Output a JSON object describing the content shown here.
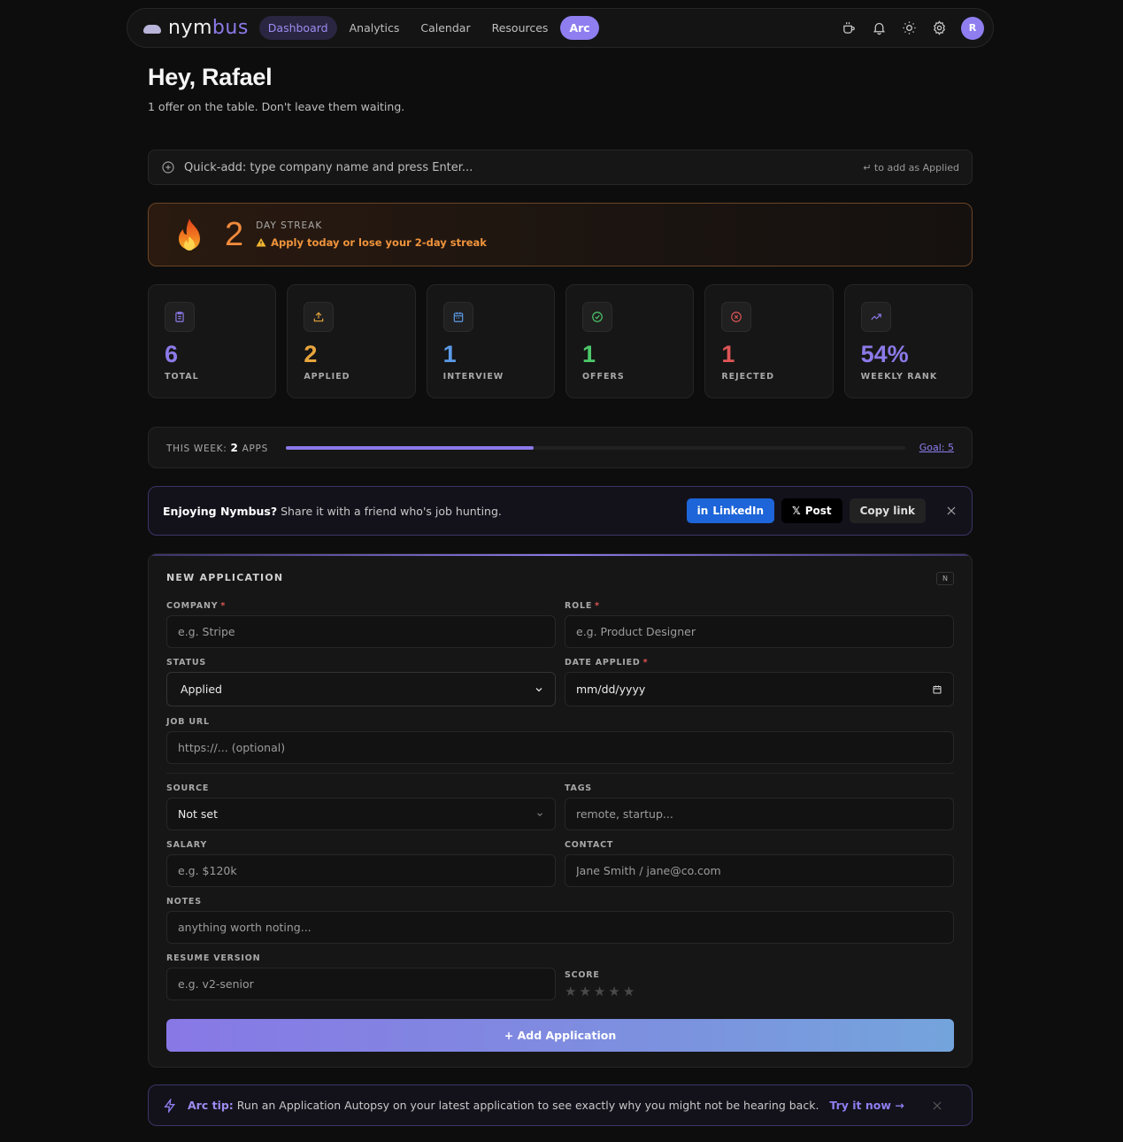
{
  "nav": {
    "logo_main": "nym",
    "logo_accent": "bus",
    "links": [
      {
        "label": "Dashboard",
        "active": true
      },
      {
        "label": "Analytics"
      },
      {
        "label": "Calendar"
      },
      {
        "label": "Resources"
      },
      {
        "label": "Arc"
      }
    ],
    "icons": [
      "coffee-icon",
      "bell-icon",
      "sun-icon",
      "gear-icon"
    ],
    "avatar_initial": "R"
  },
  "header": {
    "greeting": "Hey, Rafael",
    "subtitle": "1 offer on the table. Don't leave them waiting."
  },
  "quick_add": {
    "placeholder": "Quick-add: type company name and press Enter...",
    "hint": "↵ to add as Applied"
  },
  "streak": {
    "count": "2",
    "label": "DAY STREAK",
    "warning": "Apply today or lose your 2-day streak"
  },
  "stats": [
    {
      "value": "6",
      "label": "TOTAL",
      "color": "#8b7ae8",
      "icon": "clipboard-icon"
    },
    {
      "value": "2",
      "label": "APPLIED",
      "color": "#e8a53c",
      "icon": "upload-icon"
    },
    {
      "value": "1",
      "label": "INTERVIEW",
      "color": "#5b9be8",
      "icon": "calendar-icon"
    },
    {
      "value": "1",
      "label": "OFFERS",
      "color": "#4cc96a",
      "icon": "check-circle-icon"
    },
    {
      "value": "1",
      "label": "REJECTED",
      "color": "#e05555",
      "icon": "x-circle-icon"
    },
    {
      "value": "54%",
      "label": "WEEKLY RANK",
      "color": "#8b7ae8",
      "icon": "trending-up-icon"
    }
  ],
  "week": {
    "label_prefix": "THIS WEEK:",
    "count": "2",
    "label_suffix": "APPS",
    "progress": 0.4,
    "goal_label": "Goal: 5"
  },
  "share": {
    "bold": "Enjoying Nymbus?",
    "text": "Share it with a friend who's job hunting.",
    "linkedin": "LinkedIn",
    "post": "Post",
    "copy": "Copy link"
  },
  "form": {
    "title": "NEW APPLICATION",
    "shortcut": "N",
    "company_label": "COMPANY",
    "company_placeholder": "e.g. Stripe",
    "role_label": "ROLE",
    "role_placeholder": "e.g. Product Designer",
    "status_label": "STATUS",
    "status_value": "Applied",
    "date_label": "DATE APPLIED",
    "date_value": "mm/dd/yyyy",
    "url_label": "JOB URL",
    "url_placeholder": "https://... (optional)",
    "source_label": "SOURCE",
    "source_value": "Not set",
    "tags_label": "TAGS",
    "tags_placeholder": "remote, startup...",
    "salary_label": "SALARY",
    "salary_placeholder": "e.g. $120k",
    "contact_label": "CONTACT",
    "contact_placeholder": "Jane Smith / jane@co.com",
    "notes_label": "NOTES",
    "notes_placeholder": "anything worth noting...",
    "resume_label": "RESUME VERSION",
    "resume_placeholder": "e.g. v2-senior",
    "score_label": "SCORE",
    "score_value": 0,
    "score_max": 5,
    "submit": "+ Add Application"
  },
  "tip": {
    "bold": "Arc tip:",
    "text": "Run an Application Autopsy on your latest application to see exactly why you might not be hearing back.",
    "link": "Try it now →"
  }
}
